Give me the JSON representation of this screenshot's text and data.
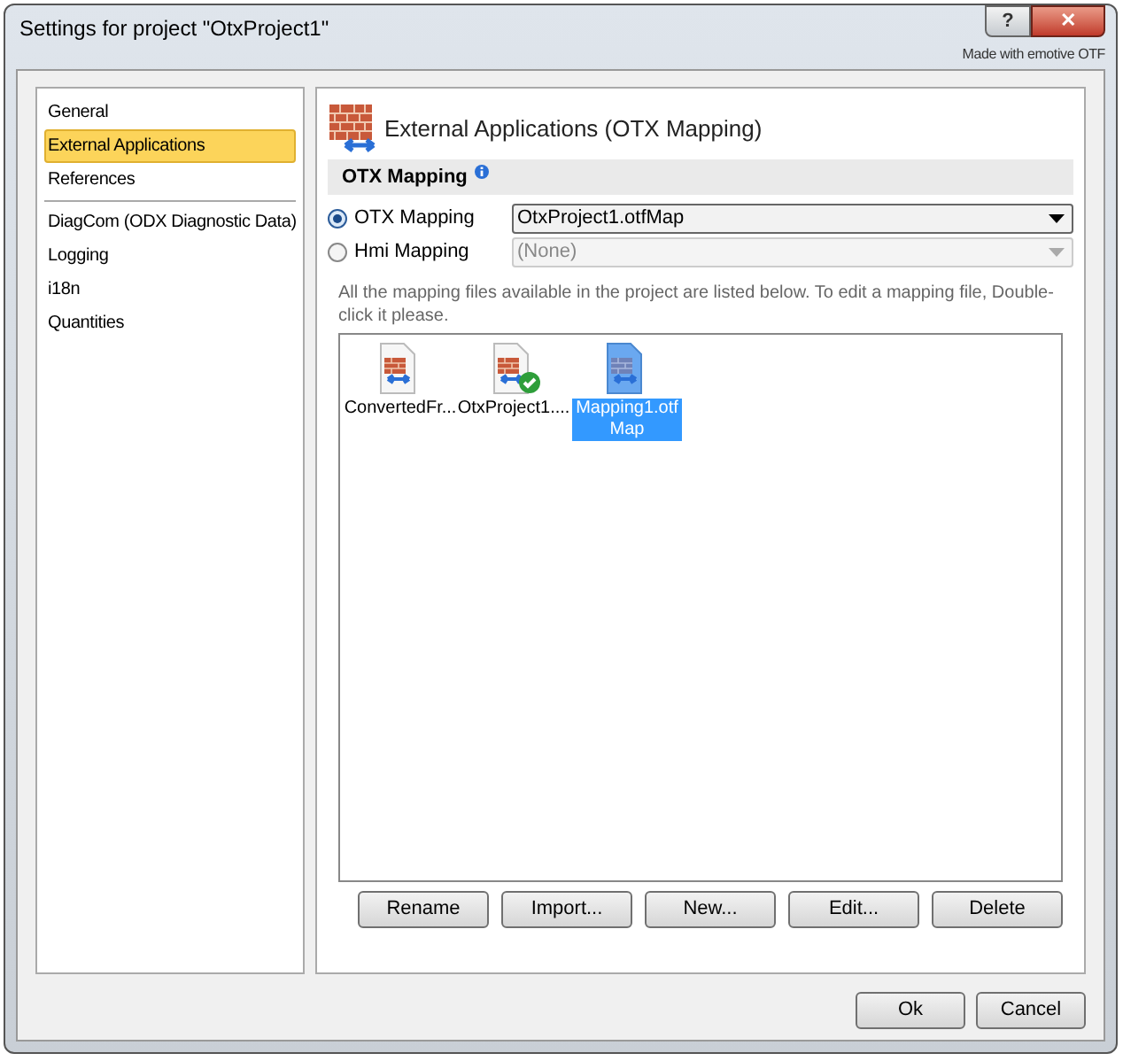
{
  "window": {
    "title": "Settings for project \"OtxProject1\"",
    "help_button": "?",
    "close_button": "✕",
    "branding": "Made with emotive OTF"
  },
  "sidebar": {
    "groups": [
      [
        {
          "label": "General",
          "selected": false
        },
        {
          "label": "External Applications",
          "selected": true
        },
        {
          "label": "References",
          "selected": false
        }
      ],
      [
        {
          "label": "DiagCom (ODX Diagnostic Data)",
          "selected": false
        },
        {
          "label": "Logging",
          "selected": false
        },
        {
          "label": "i18n",
          "selected": false
        },
        {
          "label": "Quantities",
          "selected": false
        }
      ]
    ]
  },
  "page": {
    "title": "External Applications (OTX Mapping)",
    "section": "OTX Mapping",
    "options": [
      {
        "label": "OTX Mapping",
        "selected": true,
        "dropdown": {
          "value": "OtxProject1.otfMap",
          "disabled": false
        }
      },
      {
        "label": "Hmi Mapping",
        "selected": false,
        "dropdown": {
          "value": "(None)",
          "disabled": true
        }
      }
    ],
    "hint": "All the mapping files available in the project are listed below. To edit a mapping file, Double-click it please.",
    "files": [
      {
        "name": "ConvertedFr...",
        "kind": "mapping",
        "selected": false
      },
      {
        "name": "OtxProject1....",
        "kind": "valid",
        "selected": false
      },
      {
        "name": "Mapping1.otfMap",
        "kind": "mapping",
        "selected": true
      }
    ],
    "file_buttons": [
      "Rename",
      "Import...",
      "New...",
      "Edit...",
      "Delete"
    ]
  },
  "buttons": [
    "Ok",
    "Cancel"
  ]
}
